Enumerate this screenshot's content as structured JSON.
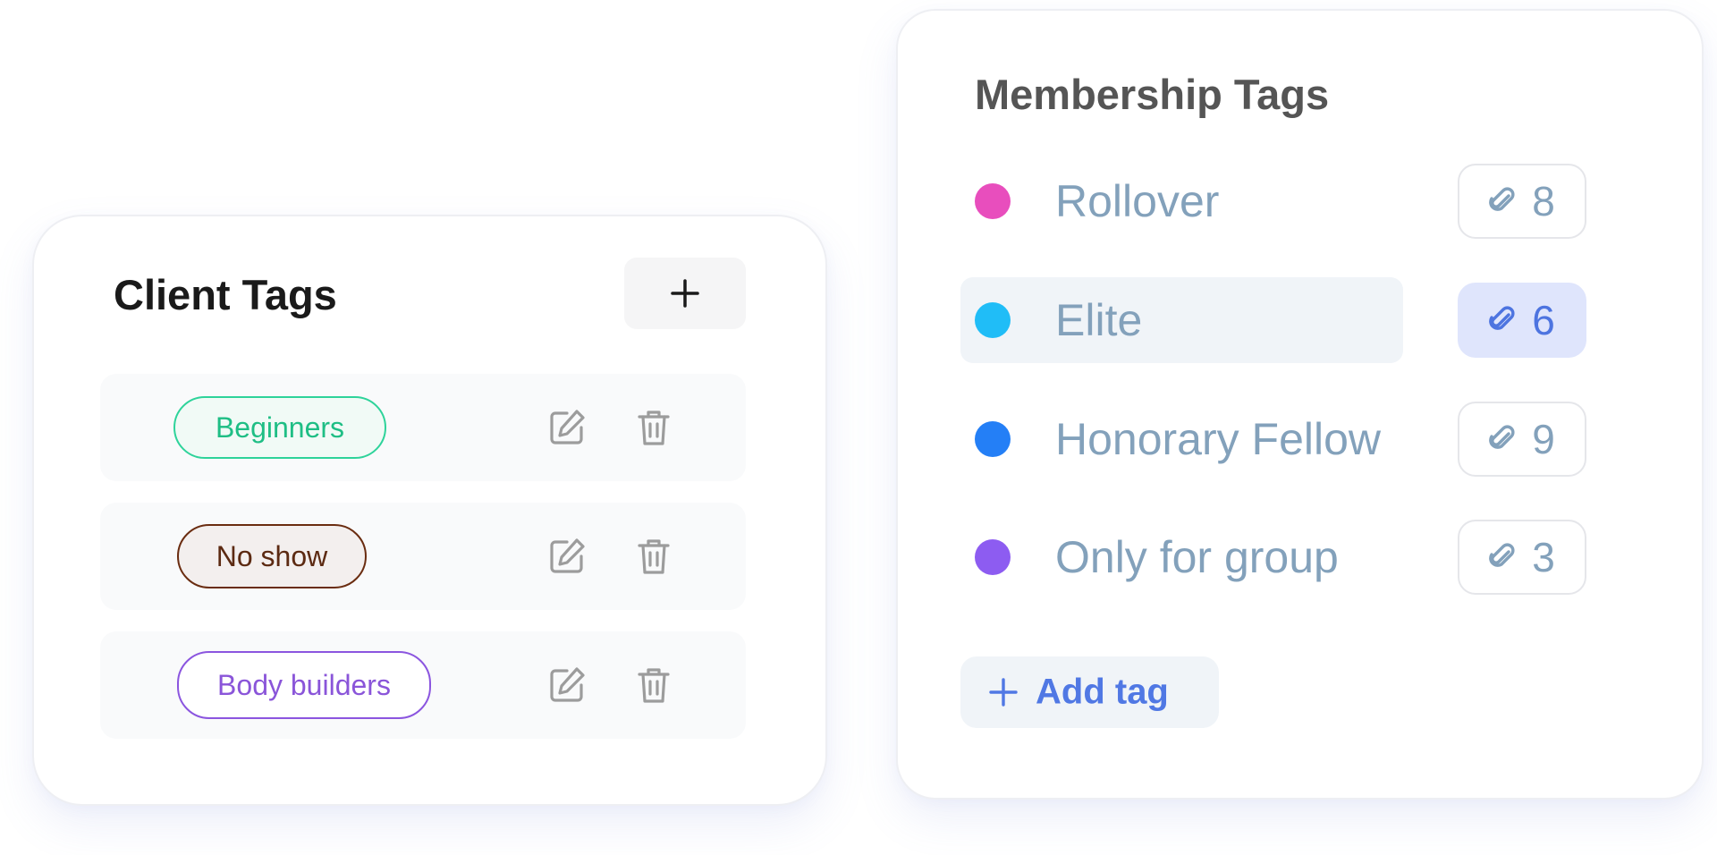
{
  "client_tags": {
    "title": "Client Tags",
    "add_button": {
      "icon": "plus-icon",
      "color": "#1a1a1a"
    },
    "tags": [
      {
        "label": "Beginners",
        "text_color": "#1fbe85",
        "border_color": "#2ed39a",
        "background": "#f1faf6"
      },
      {
        "label": "No show",
        "text_color": "#5c2a12",
        "border_color": "#6a2c10",
        "background": "#f3efee"
      },
      {
        "label": "Body builders",
        "text_color": "#8a55d9",
        "border_color": "#8b55df",
        "background": "#ffffff"
      }
    ],
    "row_actions": [
      {
        "name": "edit",
        "icon": "edit-icon"
      },
      {
        "name": "delete",
        "icon": "trash-icon"
      }
    ],
    "icon_color": "#9c9c9c"
  },
  "membership_tags": {
    "title": "Membership Tags",
    "items": [
      {
        "label": "Rollover",
        "dot_color": "#e84ebd",
        "count": "8",
        "selected": false
      },
      {
        "label": "Elite",
        "dot_color": "#20bdf7",
        "count": "6",
        "selected": true
      },
      {
        "label": "Honorary Fellow",
        "dot_color": "#247ff6",
        "count": "9",
        "selected": false
      },
      {
        "label": "Only for group",
        "dot_color": "#8d5cf1",
        "count": "3",
        "selected": false
      }
    ],
    "count_icon": "paperclip-icon",
    "add_tag": {
      "label": "Add tag",
      "icon": "plus-icon"
    },
    "colors": {
      "label": "#83a1bb",
      "accent": "#5078e4",
      "selected_row": "#f0f4f8",
      "active_count": "#dfe5fc"
    }
  }
}
